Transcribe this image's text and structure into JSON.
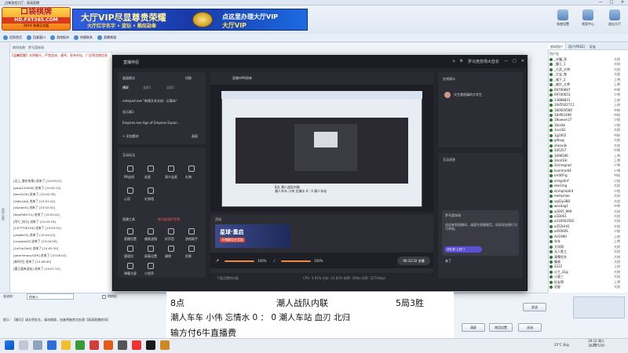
{
  "window": {
    "title": "边锋游戏大厅 - 高清直播"
  },
  "banner": {
    "logo_main": "口袋棋牌",
    "logo_url": "HD.FXT365.COM",
    "logo_sub": "2019 秋季正式版",
    "promo_title": "大厅VIP尽显尊贵荣耀",
    "promo_sub": "大厅红字名字 • 蓝钻 • 酷炫勋章",
    "promo_right1": "点这里办理大厅VIP",
    "promo_right2": "大厅VIP"
  },
  "top_icons": [
    {
      "label": "系统设置",
      "icon": "gear-icon"
    },
    {
      "label": "领奖中心",
      "icon": "gift-icon"
    },
    {
      "label": "首页",
      "icon": "home-icon"
    },
    {
      "label": "退出大厅",
      "icon": "exit-icon"
    }
  ],
  "toolbar": [
    {
      "label": "回到首页",
      "icon": "home-icon"
    },
    {
      "label": "回复窗口",
      "icon": "reply-icon"
    },
    {
      "label": "游戏板块",
      "icon": "game-icon"
    },
    {
      "label": "快捷联系",
      "icon": "contact-icon"
    },
    {
      "label": "直播频道",
      "icon": "live-icon"
    }
  ],
  "left_panel": {
    "vertical_label": "大厅公告"
  },
  "chat": {
    "header": "房间名称：罗马竞技场",
    "notice": "【温馨提醒】文明聊天，严禁造谣、谩骂、发布外挂、广告等违规信息",
    "lines": [
      "[无上_聊应有情] 进来了 [14:59:01]",
      "[poqs12d456] 进来了 [15:00:12]",
      "[bee2026] 进来了 [15:00:35]",
      "[2s8v2dd] 进来了 [15:01:10]",
      "[skystarS] 进来了 [15:02:03]",
      "[NeoFNN714] 进来了 [15:02:41]",
      "[阿七_快马] 进来了 [15:03:18]",
      "[12F7T0K316] 进来了 [15:03:55]",
      "[yea8b33] 进来了 [15:04:22]",
      "[ruosaidoZ] 进来了 [15:04:59]",
      "[1a52a1fa5] 进来了 [15:05:30]",
      "[peachmanyGDR] 进来了 [15:06:02]",
      "[新时代] 进来了 [15:06:40]",
      "[霸王盖有战站] 进来了 [15:07:15]"
    ]
  },
  "send": {
    "label": "发送给：",
    "input": "所有人",
    "checkbox": "悄悄话"
  },
  "tip": "提示：【聊天】请文明发言，请勿刷屏，违者将被禁言处理【高清直播房间】",
  "buttons": {
    "send": "发送",
    "settings": "常用设置",
    "clear": "清屏",
    "close": "关闭"
  },
  "right_panel": {
    "tabs": [
      "房间用户",
      "用户(P562)",
      "好友"
    ],
    "head": "用户名",
    "users": [
      {
        "name": "_光耀_亮",
        "rank": "大校",
        "color": "#2c7a2c"
      },
      {
        "name": "_霸王_1",
        "rank": "大校",
        "color": "#2c7a2c"
      },
      {
        "name": "_七武_大将",
        "rank": "大校",
        "color": "#2c7a2c"
      },
      {
        "name": "_大宝_鬼",
        "rank": "大校",
        "color": "#2c7a2c"
      },
      {
        "name": "_城下_2",
        "rank": "上将",
        "color": "#2c7a2c"
      },
      {
        "name": "_威尔_大将",
        "rank": "上将",
        "color": "#2c7a2c"
      },
      {
        "name": "09700687",
        "rank": "中将",
        "color": "#2c7a2c"
      },
      {
        "name": "09700653",
        "rank": "少将",
        "color": "#2c7a2c"
      },
      {
        "name": "13888831",
        "rank": "上校",
        "color": "#2c7a2c"
      },
      {
        "name": "16d5S02711",
        "rank": "上校",
        "color": "#2c7a2c"
      },
      {
        "name": "180000580",
        "rank": "中校",
        "color": "#2c7a2c"
      },
      {
        "name": "18dfS1498",
        "rank": "中校",
        "color": "#2c7a2c"
      },
      {
        "name": "1Bowser27",
        "rank": "少校",
        "color": "#2c7a2c"
      },
      {
        "name": "1bcsKe",
        "rank": "少校",
        "color": "#2c7a2c"
      },
      {
        "name": "1ocoS2",
        "rank": "大尉",
        "color": "#2c7a2c"
      },
      {
        "name": "1g2002",
        "rank": "中尉",
        "color": "#2c7a2c"
      },
      {
        "name": "g4bug",
        "rank": "大校",
        "color": "#2c7a2c"
      },
      {
        "name": "sheasilk",
        "rank": "大校",
        "color": "#2c7a2c"
      },
      {
        "name": "3d52S7",
        "rank": "中将",
        "color": "#2c7a2c"
      },
      {
        "name": "3d96S96",
        "rank": "上将",
        "color": "#2c7a2c"
      },
      {
        "name": "3mmS3r",
        "rank": "上将",
        "color": "#2c7a2c"
      },
      {
        "name": "3cmmgrad",
        "rank": "少将",
        "color": "#2c7a2c"
      },
      {
        "name": "kummar64",
        "rank": "少将",
        "color": "#2c7a2c"
      },
      {
        "name": "mrd0Frg",
        "rank": "中校",
        "color": "#2c7a2c"
      },
      {
        "name": "smigs0nF",
        "rank": "少校",
        "color": "#2c7a2c"
      },
      {
        "name": "dxe1mg",
        "rank": "大校",
        "color": "#2c7a2c"
      },
      {
        "name": "dcmqmb4rd",
        "rank": "少校",
        "color": "#2c7a2c"
      },
      {
        "name": "mellymae",
        "rank": "大校",
        "color": "#2c7a2c"
      },
      {
        "name": "sq42p388",
        "rank": "大校",
        "color": "#2c7a2c"
      },
      {
        "name": "wosdag1",
        "rank": "中将",
        "color": "#2c7a2c"
      },
      {
        "name": "a2005_999",
        "rank": "大校",
        "color": "#2c7a2c"
      },
      {
        "name": "a1D0S1",
        "rank": "大校",
        "color": "#2c7a2c"
      },
      {
        "name": "a2160S3562",
        "rank": "大校",
        "color": "#2c7a2c"
      },
      {
        "name": "a252Hrd1",
        "rank": "大校",
        "color": "#2c7a2c"
      },
      {
        "name": "ad5060S",
        "rank": "少校",
        "color": "#2c7a2c"
      },
      {
        "name": "AU1990",
        "rank": "上校",
        "color": "#2c7a2c"
      },
      {
        "name": "车车",
        "rank": "上将",
        "color": "#2c7a2c"
      },
      {
        "name": "大叫哥",
        "rank": "大校",
        "color": "#2c7a2c"
      },
      {
        "name": "无人胜之",
        "rank": "大校",
        "color": "#2c7a2c"
      },
      {
        "name": "清零优先",
        "rank": "大校",
        "color": "#2c7a2c"
      },
      {
        "name": "霸道",
        "rank": "大校",
        "color": "#2c7a2c"
      },
      {
        "name": "2222",
        "rank": "上校",
        "color": "#2c7a2c"
      },
      {
        "name": "火工_风云",
        "rank": "大校",
        "color": "#2c7a2c"
      },
      {
        "name": "小蛮三",
        "rank": "大校",
        "color": "#2c7a2c"
      },
      {
        "name": "好友啊",
        "rank": "上将",
        "color": "#2c7a2c"
      },
      {
        "name": "泥屋",
        "rank": "大校",
        "color": "#2c7a2c"
      }
    ]
  },
  "obs": {
    "title": "直播伴侣",
    "right_header": "罗马竞技场大酋长",
    "scene_label": "画面模式",
    "scene_action": "切换",
    "scene_tabs": [
      "横屏",
      "竖屏1",
      "竖屏2"
    ],
    "sources_label": "来源",
    "sources": [
      "notepad.exe \"新建文本文档 - 记事本\"",
      "显示器1",
      "Empires.exe Age of Empires Expan..."
    ],
    "add_source": "+ 添加素材",
    "add_source_right": "画面",
    "interact_label": "互动玩法",
    "interact_items": [
      "PK连线",
      "连麦",
      "观众连麦",
      "礼物",
      "心愿",
      "礼物墙"
    ],
    "tools_label": "直播工具",
    "tools_tip": "·新功能限时免费",
    "tools_items": [
      "直播设置",
      "美颜滤镜",
      "好声音",
      "游戏助手",
      "管理员",
      "屏蔽设置",
      "福袋",
      "投票",
      "弹幕大屏",
      "小程序"
    ],
    "preview_label": "直播中PK榜单",
    "activity_label": "活动",
    "activity_banner_title": "星球·重启",
    "activity_banner_sub": "开播赢现金奖励",
    "volume1": "100%",
    "volume2": "100%",
    "timer": "00:12:32",
    "go_live": "关播",
    "status": "CPU: 3.91%   内存: 21.83%   帧率: 30fps   码率: 2273kbps",
    "status_left": "下面设置的内容",
    "online_label": "在线观众",
    "online_user": "天生就很痛的大学生",
    "interact_msgs_label": "互动消息",
    "chat_welcome": "欢迎来到直播间，请遵守直播规范，如发现违规行为可举报。",
    "donate": "送礼物·上热门",
    "chat_user": "罗马竞技场",
    "chat_text": "来了",
    "inner_text1": "8点                  潮人战队内联",
    "inner_text2": "潮人车车 小伟 忘情水 0：0 潮人车站"
  },
  "overlay": {
    "line1_left": "8点",
    "line1_mid": "潮人战队内联",
    "line1_right": "5局3胜",
    "line2": "潮人车车  小伟  忘情水    0  ：  0    潮人车站   血刃   北归",
    "line3": "输方付6牛直播费"
  },
  "taskbar": {
    "weather": "25°C 多云",
    "time": "20:12 周二",
    "date": "2022/7/19",
    "ime": "中"
  }
}
